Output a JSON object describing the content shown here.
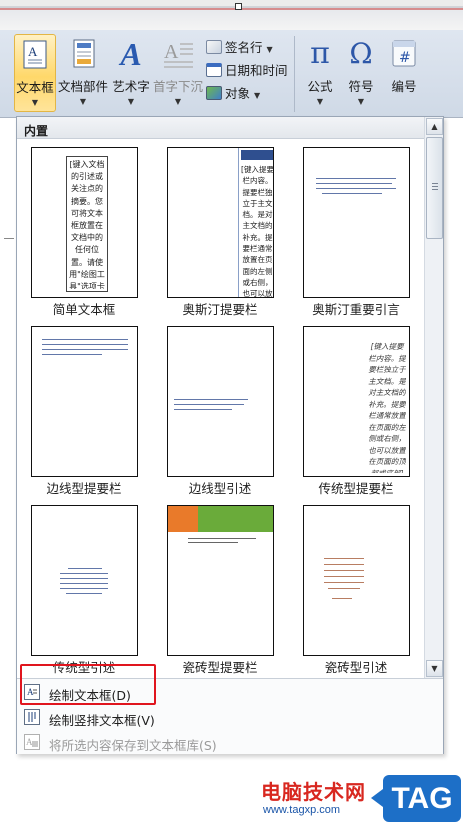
{
  "ribbon": {
    "textbox_label": "文本框",
    "docparts_label": "文档部件",
    "wordart_label": "艺术字",
    "dropcap_label": "首字下沉",
    "sigline_label": "签名行",
    "datetime_label": "日期和时间",
    "object_label": "对象",
    "equation_label": "公式",
    "symbol_label": "符号",
    "number_label": "编号",
    "equation_glyph": "π",
    "symbol_glyph": "Ω",
    "number_glyph": "#",
    "wordart_glyph": "A"
  },
  "gallery": {
    "header": "内置",
    "items": [
      {
        "name": "简单文本框",
        "preview": "[键入文档的引述或关注点的摘要。您可将文本框放置在文档中的任何位置。请使用\"绘图工具\"选项卡更改引言文本框的格式。]"
      },
      {
        "name": "奥斯汀提要栏",
        "preview": "[键入提要栏内容。提要栏独立于主文档。是对主文档的补充。提要栏通常放置在页面的左侧或右侧，也可以放置"
      },
      {
        "name": "奥斯汀重要引言",
        "preview": ""
      },
      {
        "name": "边线型提要栏",
        "preview": ""
      },
      {
        "name": "边线型引述",
        "preview": ""
      },
      {
        "name": "传统型提要栏",
        "preview": "[键入提要栏内容。提要栏独立于主文档。是对主文档的补充。提要栏通常放置在页面的左侧或右侧，也可以放置在页面的顶部或底部]"
      },
      {
        "name": "传统型引述",
        "preview": ""
      },
      {
        "name": "瓷砖型提要栏",
        "preview": ""
      },
      {
        "name": "瓷砖型引述",
        "preview": ""
      }
    ]
  },
  "menu": {
    "draw_textbox": "绘制文本框(D)",
    "draw_vertical_textbox": "绘制竖排文本框(V)",
    "save_selection": "将所选内容保存到文本框库(S)"
  },
  "watermark": {
    "title": "电脑技术网",
    "url": "www.tagxp.com",
    "tag": "TAG"
  },
  "colors": {
    "accent_highlight": "#e0151e",
    "selected_button": "#ffd86a",
    "tile_orange": "#e97a2a",
    "tile_green": "#6aab3a",
    "austin_blue": "#2f4f8f"
  }
}
